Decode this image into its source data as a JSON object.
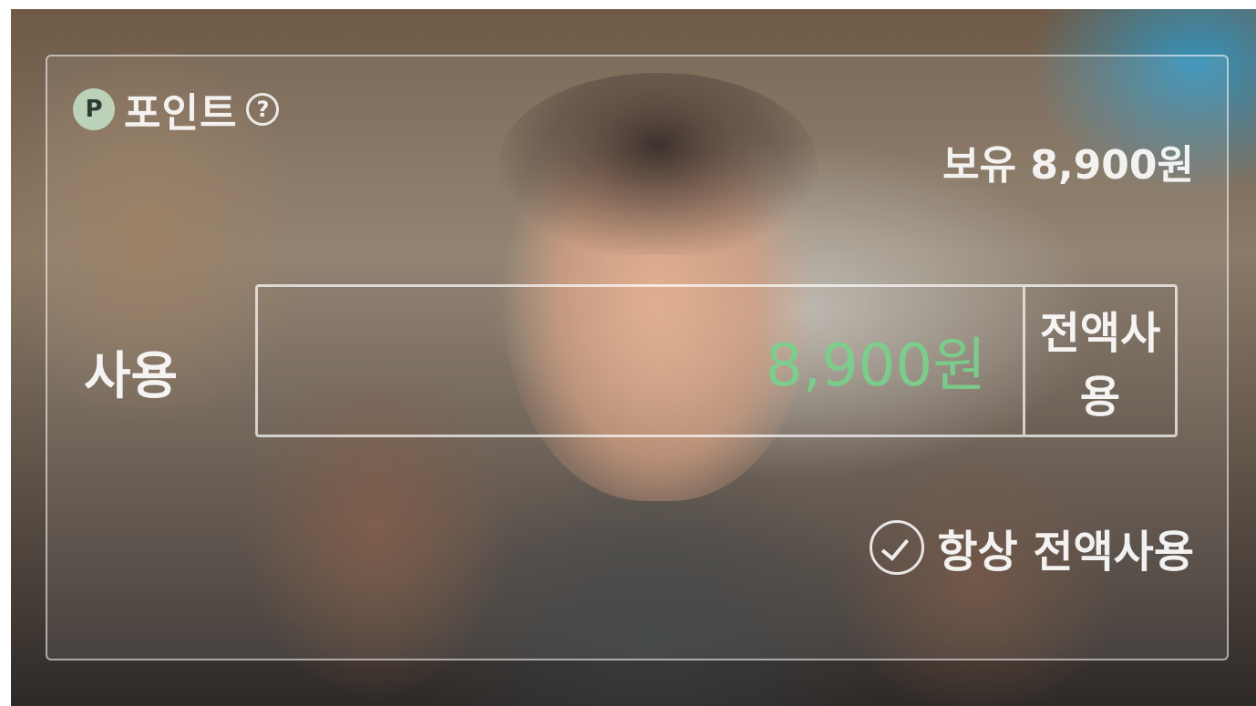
{
  "points_panel": {
    "badge_letter": "P",
    "title": "포인트",
    "help_icon_glyph": "?",
    "balance": "보유 8,900원"
  },
  "use_section": {
    "label": "사용",
    "amount_value": "8,900원",
    "use_all_label": "전액사용"
  },
  "always_use_all": {
    "label": "항상 전액사용",
    "checked": true
  },
  "colors": {
    "amount_text": "#78d28c",
    "panel_border": "#ffffff"
  },
  "icons": [
    "points-badge-icon",
    "help-icon",
    "checkmark-circle-icon"
  ]
}
